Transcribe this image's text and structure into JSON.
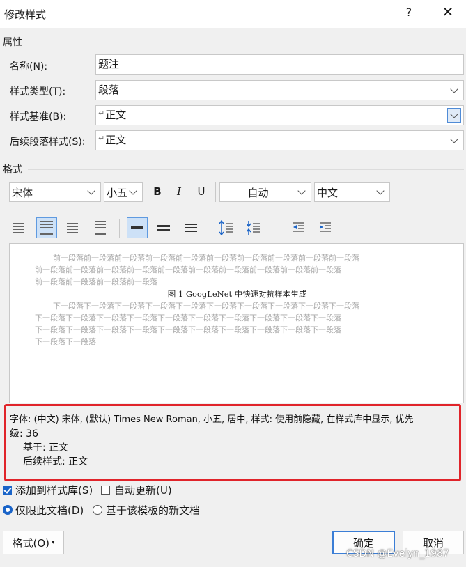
{
  "window": {
    "title": "修改样式",
    "help": "?",
    "close": "✕"
  },
  "properties": {
    "heading": "属性",
    "name": {
      "label": "名称(N):",
      "value": "题注"
    },
    "style_type": {
      "label": "样式类型(T):",
      "value": "段落"
    },
    "based_on": {
      "label": "样式基准(B):",
      "mark": "↵",
      "value": "正文"
    },
    "next_style": {
      "label": "后续段落样式(S):",
      "mark": "↵",
      "value": "正文"
    }
  },
  "format": {
    "heading": "格式",
    "font": "宋体",
    "size": "小五",
    "bold": "B",
    "italic": "I",
    "underline": "U",
    "color": "自动",
    "script": "中文"
  },
  "preview": {
    "prev_lines": [
      "前一段落前一段落前一段落前一段落前一段落前一段落前一段落前一段落前一段落前一段落",
      "前一段落前一段落前一段落前一段落前一段落前一段落前一段落前一段落前一段落前一段落",
      "前一段落前一段落前一段落前一段落"
    ],
    "caption": "图  1 GoogLeNet 中快速对抗样本生成",
    "next_lines": [
      "下一段落下一段落下一段落下一段落下一段落下一段落下一段落下一段落下一段落下一段落",
      "下一段落下一段落下一段落下一段落下一段落下一段落下一段落下一段落下一段落下一段落",
      "下一段落下一段落下一段落下一段落下一段落下一段落下一段落下一段落下一段落下一段落",
      "下一段落下一段落"
    ]
  },
  "description": {
    "line1": "字体: (中文) 宋体, (默认) Times New Roman, 小五, 居中, 样式: 使用前隐藏, 在样式库中显示, 优先",
    "line2": "级: 36",
    "line3": "基于: 正文",
    "line4": "后续样式: 正文"
  },
  "options": {
    "add_to_gallery": {
      "label": "添加到样式库(S)",
      "checked": true
    },
    "auto_update": {
      "label": "自动更新(U)",
      "checked": false
    },
    "this_doc_only": {
      "label": "仅限此文档(D)",
      "selected": true
    },
    "new_docs": {
      "label": "基于该模板的新文档",
      "selected": false
    }
  },
  "buttons": {
    "format": "格式(O)",
    "ok": "确定",
    "cancel": "取消"
  },
  "watermark": "CSDN @Evelyn_1987",
  "colors": {
    "highlight": "#e0242a",
    "accent": "#1a64c8"
  }
}
